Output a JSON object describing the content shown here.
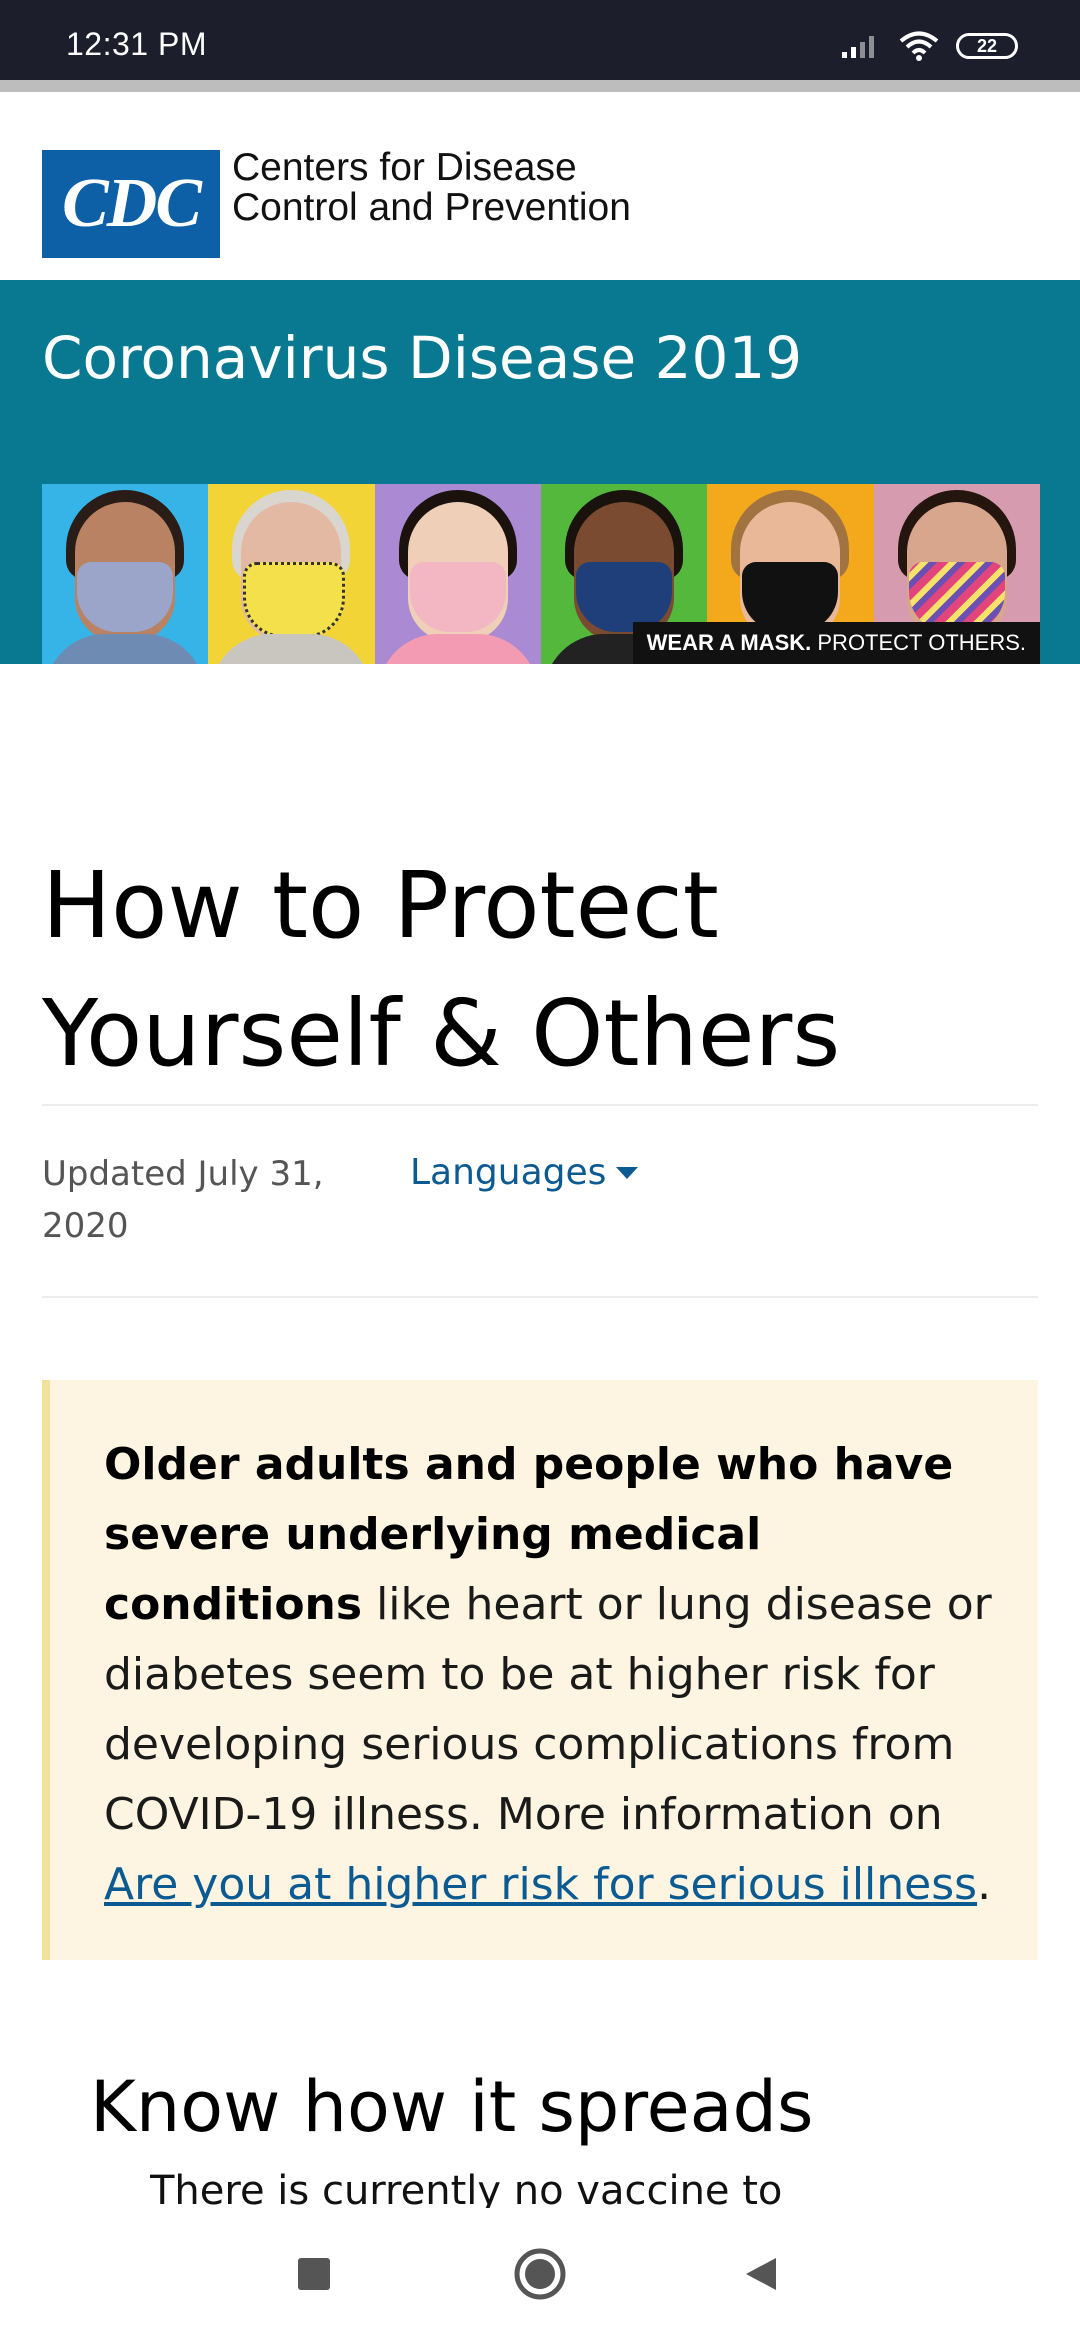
{
  "status_bar": {
    "time": "12:31 PM",
    "battery": "22",
    "signal_icon": "signal-icon",
    "wifi_icon": "wifi-icon"
  },
  "header": {
    "logo_text": "CDC",
    "org_line1": "Centers for Disease",
    "org_line2": "Control and Prevention"
  },
  "banner": {
    "title": "Coronavirus Disease 2019",
    "caption_bold": "WEAR A MASK.",
    "caption_rest": " PROTECT OTHERS."
  },
  "main": {
    "title": "How to Protect Yourself & Others",
    "updated": "Updated July 31, 2020",
    "languages_label": "Languages",
    "callout": {
      "bold": "Older adults and people who have severe underlying medical conditions",
      "text": " like heart or lung disease or diabetes seem to be at higher risk for developing serious complications from COVID-19 illness. More information on ",
      "link": "Are you at higher risk for serious illness",
      "end": "."
    },
    "section_title": "Know how it spreads",
    "bullet_1": "There is currently no vaccine to"
  },
  "colors": {
    "banner": "#087990",
    "callout_bg": "#fdf5e1",
    "link": "#0b5a92",
    "logo": "#0d5fa6"
  },
  "nav_bar": {
    "recents_icon": "square-recents-icon",
    "home_icon": "circle-home-icon",
    "back_icon": "triangle-back-icon"
  }
}
